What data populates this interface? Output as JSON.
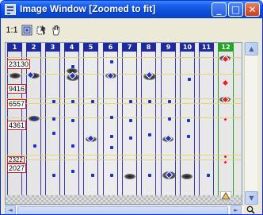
{
  "window": {
    "title": "Image Window [Zoomed to fit]",
    "controls": {
      "minimize": "_",
      "maximize": "□",
      "close": "✕"
    },
    "colors": {
      "titlebar": "#0a4fd9",
      "close": "#c8411f"
    }
  },
  "toolbar": {
    "zoom_label": "1:1",
    "fit_icon": "zoom-to-fit-icon",
    "select_icon": "select-region-icon",
    "hand_icon": "pan-hand-icon"
  },
  "gel": {
    "lanes": [
      {
        "label": "1"
      },
      {
        "label": "2"
      },
      {
        "label": "3"
      },
      {
        "label": "4"
      },
      {
        "label": "5"
      },
      {
        "label": "6"
      },
      {
        "label": "7"
      },
      {
        "label": "8"
      },
      {
        "label": "9"
      },
      {
        "label": "10"
      },
      {
        "label": "11"
      },
      {
        "label": "12",
        "active": true
      }
    ],
    "mw_labels": [
      "23130",
      "9416",
      "6557",
      "4361",
      "2322",
      "2027"
    ],
    "colors": {
      "lane_border": "#3a3ab5",
      "lane_header": "#1f2a9e",
      "active_lane": "#22a522",
      "band_line": "#e3d36a",
      "mw_border": "#d22020"
    }
  },
  "scrollbars": {
    "up": "▲",
    "down": "▼",
    "left": "◄",
    "right": "►",
    "zoom_icon": "magnifier-icon"
  }
}
